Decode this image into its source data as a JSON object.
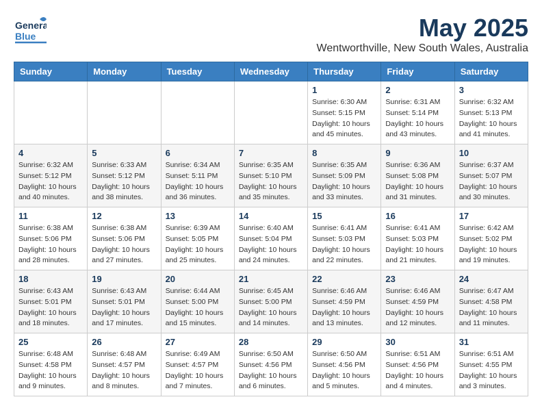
{
  "header": {
    "logo_general": "General",
    "logo_blue": "Blue",
    "month": "May 2025",
    "location": "Wentworthville, New South Wales, Australia"
  },
  "days_of_week": [
    "Sunday",
    "Monday",
    "Tuesday",
    "Wednesday",
    "Thursday",
    "Friday",
    "Saturday"
  ],
  "weeks": [
    [
      {
        "day": "",
        "info": ""
      },
      {
        "day": "",
        "info": ""
      },
      {
        "day": "",
        "info": ""
      },
      {
        "day": "",
        "info": ""
      },
      {
        "day": "1",
        "info": "Sunrise: 6:30 AM\nSunset: 5:15 PM\nDaylight: 10 hours\nand 45 minutes."
      },
      {
        "day": "2",
        "info": "Sunrise: 6:31 AM\nSunset: 5:14 PM\nDaylight: 10 hours\nand 43 minutes."
      },
      {
        "day": "3",
        "info": "Sunrise: 6:32 AM\nSunset: 5:13 PM\nDaylight: 10 hours\nand 41 minutes."
      }
    ],
    [
      {
        "day": "4",
        "info": "Sunrise: 6:32 AM\nSunset: 5:12 PM\nDaylight: 10 hours\nand 40 minutes."
      },
      {
        "day": "5",
        "info": "Sunrise: 6:33 AM\nSunset: 5:12 PM\nDaylight: 10 hours\nand 38 minutes."
      },
      {
        "day": "6",
        "info": "Sunrise: 6:34 AM\nSunset: 5:11 PM\nDaylight: 10 hours\nand 36 minutes."
      },
      {
        "day": "7",
        "info": "Sunrise: 6:35 AM\nSunset: 5:10 PM\nDaylight: 10 hours\nand 35 minutes."
      },
      {
        "day": "8",
        "info": "Sunrise: 6:35 AM\nSunset: 5:09 PM\nDaylight: 10 hours\nand 33 minutes."
      },
      {
        "day": "9",
        "info": "Sunrise: 6:36 AM\nSunset: 5:08 PM\nDaylight: 10 hours\nand 31 minutes."
      },
      {
        "day": "10",
        "info": "Sunrise: 6:37 AM\nSunset: 5:07 PM\nDaylight: 10 hours\nand 30 minutes."
      }
    ],
    [
      {
        "day": "11",
        "info": "Sunrise: 6:38 AM\nSunset: 5:06 PM\nDaylight: 10 hours\nand 28 minutes."
      },
      {
        "day": "12",
        "info": "Sunrise: 6:38 AM\nSunset: 5:06 PM\nDaylight: 10 hours\nand 27 minutes."
      },
      {
        "day": "13",
        "info": "Sunrise: 6:39 AM\nSunset: 5:05 PM\nDaylight: 10 hours\nand 25 minutes."
      },
      {
        "day": "14",
        "info": "Sunrise: 6:40 AM\nSunset: 5:04 PM\nDaylight: 10 hours\nand 24 minutes."
      },
      {
        "day": "15",
        "info": "Sunrise: 6:41 AM\nSunset: 5:03 PM\nDaylight: 10 hours\nand 22 minutes."
      },
      {
        "day": "16",
        "info": "Sunrise: 6:41 AM\nSunset: 5:03 PM\nDaylight: 10 hours\nand 21 minutes."
      },
      {
        "day": "17",
        "info": "Sunrise: 6:42 AM\nSunset: 5:02 PM\nDaylight: 10 hours\nand 19 minutes."
      }
    ],
    [
      {
        "day": "18",
        "info": "Sunrise: 6:43 AM\nSunset: 5:01 PM\nDaylight: 10 hours\nand 18 minutes."
      },
      {
        "day": "19",
        "info": "Sunrise: 6:43 AM\nSunset: 5:01 PM\nDaylight: 10 hours\nand 17 minutes."
      },
      {
        "day": "20",
        "info": "Sunrise: 6:44 AM\nSunset: 5:00 PM\nDaylight: 10 hours\nand 15 minutes."
      },
      {
        "day": "21",
        "info": "Sunrise: 6:45 AM\nSunset: 5:00 PM\nDaylight: 10 hours\nand 14 minutes."
      },
      {
        "day": "22",
        "info": "Sunrise: 6:46 AM\nSunset: 4:59 PM\nDaylight: 10 hours\nand 13 minutes."
      },
      {
        "day": "23",
        "info": "Sunrise: 6:46 AM\nSunset: 4:59 PM\nDaylight: 10 hours\nand 12 minutes."
      },
      {
        "day": "24",
        "info": "Sunrise: 6:47 AM\nSunset: 4:58 PM\nDaylight: 10 hours\nand 11 minutes."
      }
    ],
    [
      {
        "day": "25",
        "info": "Sunrise: 6:48 AM\nSunset: 4:58 PM\nDaylight: 10 hours\nand 9 minutes."
      },
      {
        "day": "26",
        "info": "Sunrise: 6:48 AM\nSunset: 4:57 PM\nDaylight: 10 hours\nand 8 minutes."
      },
      {
        "day": "27",
        "info": "Sunrise: 6:49 AM\nSunset: 4:57 PM\nDaylight: 10 hours\nand 7 minutes."
      },
      {
        "day": "28",
        "info": "Sunrise: 6:50 AM\nSunset: 4:56 PM\nDaylight: 10 hours\nand 6 minutes."
      },
      {
        "day": "29",
        "info": "Sunrise: 6:50 AM\nSunset: 4:56 PM\nDaylight: 10 hours\nand 5 minutes."
      },
      {
        "day": "30",
        "info": "Sunrise: 6:51 AM\nSunset: 4:56 PM\nDaylight: 10 hours\nand 4 minutes."
      },
      {
        "day": "31",
        "info": "Sunrise: 6:51 AM\nSunset: 4:55 PM\nDaylight: 10 hours\nand 3 minutes."
      }
    ]
  ]
}
